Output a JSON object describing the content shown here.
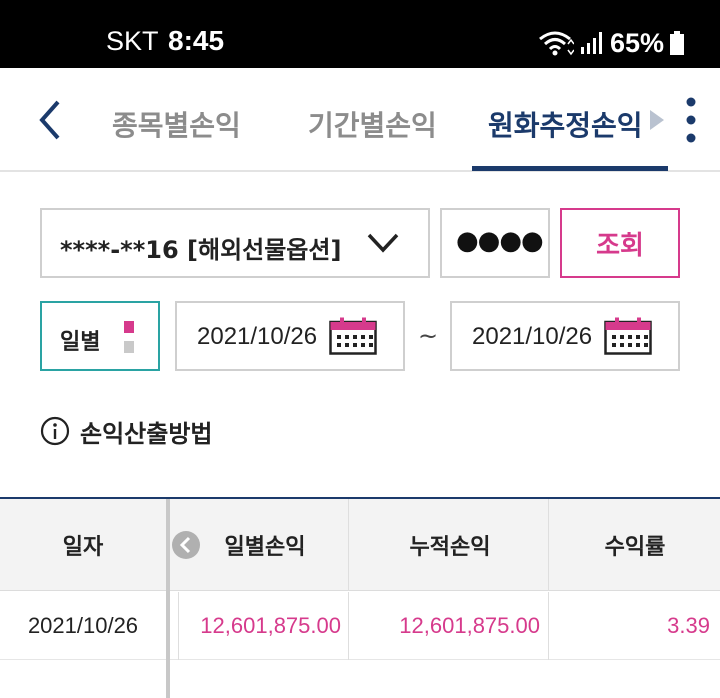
{
  "status_bar": {
    "carrier": "SKT",
    "time": "8:45",
    "battery": "65%",
    "icons": [
      "wifi-icon",
      "signal-icon",
      "battery-icon"
    ]
  },
  "header": {
    "tabs": [
      {
        "label": "종목별손익",
        "active": false
      },
      {
        "label": "기간별손익",
        "active": false
      },
      {
        "label": "원화추정손익",
        "active": true
      }
    ]
  },
  "form": {
    "account": "****-**16 [해외선물옵션]",
    "password_mask": "●●●●",
    "query_label": "조회",
    "period_label": "일별",
    "date_from": "2021/10/26",
    "date_to": "2021/10/26",
    "tilde": "~"
  },
  "info": {
    "label": "손익산출방법"
  },
  "table": {
    "headers": [
      "일자",
      "일별손익",
      "누적손익",
      "수익률"
    ],
    "rows": [
      {
        "date": "2021/10/26",
        "daily": "12,601,875.00",
        "cumulative": "12,601,875.00",
        "rate": "3.39"
      }
    ]
  },
  "colors": {
    "accent": "#d63a8c",
    "navy": "#1b3a6b",
    "teal": "#2aa3a3"
  }
}
